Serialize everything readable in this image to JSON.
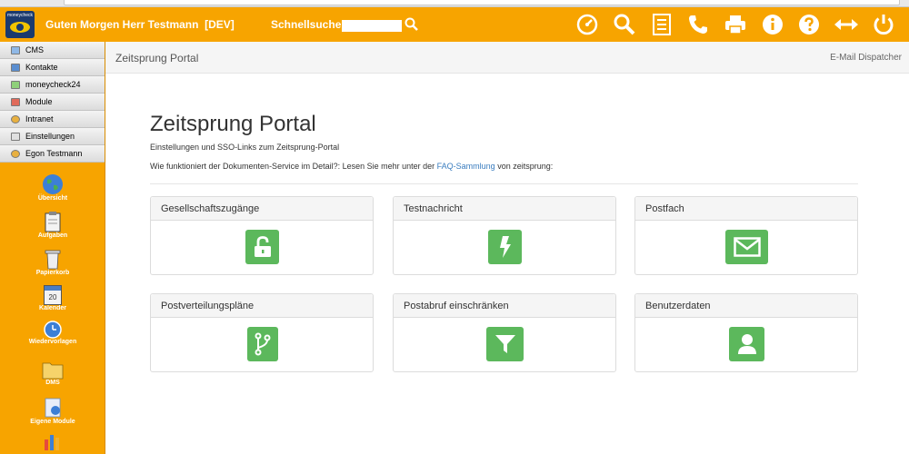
{
  "header": {
    "logo_text": "moneycheck",
    "greeting": "Guten Morgen Herr Testmann  [DEV]",
    "search_label": "Schnellsuche:",
    "search_value": ""
  },
  "sidebar": {
    "menu": [
      {
        "label": "CMS",
        "icon": "monitor-icon"
      },
      {
        "label": "Kontakte",
        "icon": "contacts-icon"
      },
      {
        "label": "moneycheck24",
        "icon": "document-icon"
      },
      {
        "label": "Module",
        "icon": "module-icon"
      },
      {
        "label": "Intranet",
        "icon": "people-icon"
      },
      {
        "label": "Einstellungen",
        "icon": "settings-icon"
      },
      {
        "label": "Egon Testmann",
        "icon": "user-icon"
      }
    ],
    "quick": [
      {
        "label": "Übersicht",
        "icon": "globe-icon"
      },
      {
        "label": "Aufgaben",
        "icon": "clipboard-icon"
      },
      {
        "label": "Papierkorb",
        "icon": "trash-icon"
      },
      {
        "label": "Kalender",
        "icon": "calendar-icon",
        "day": "20"
      },
      {
        "label": "Wiedervorlagen",
        "icon": "clock-icon"
      },
      {
        "label": "DMS",
        "icon": "folder-icon"
      },
      {
        "label": "Eigene Module",
        "icon": "puzzle-icon"
      }
    ]
  },
  "content": {
    "breadcrumb": "Zeitsprung Portal",
    "email_dispatcher": "E-Mail Dispatcher",
    "title": "Zeitsprung Portal",
    "description": "Einstellungen und SSO-Links zum Zeitsprung-Portal",
    "info_prefix": "Wie funktioniert der Dokumenten-Service im Detail?: Lesen Sie mehr unter der ",
    "info_link": "FAQ-Sammlung",
    "info_suffix": " von zeitsprung:",
    "panels": [
      {
        "title": "Gesellschaftszugänge",
        "icon": "unlock-icon"
      },
      {
        "title": "Testnachricht",
        "icon": "lightning-icon"
      },
      {
        "title": "Postfach",
        "icon": "envelope-icon"
      },
      {
        "title": "Postverteilungspläne",
        "icon": "branch-icon"
      },
      {
        "title": "Postabruf einschränken",
        "icon": "filter-icon"
      },
      {
        "title": "Benutzerdaten",
        "icon": "user-icon"
      }
    ]
  },
  "colors": {
    "brand_orange": "#f7a400",
    "button_green": "#5cb85c",
    "link_blue": "#3a7dbf"
  }
}
